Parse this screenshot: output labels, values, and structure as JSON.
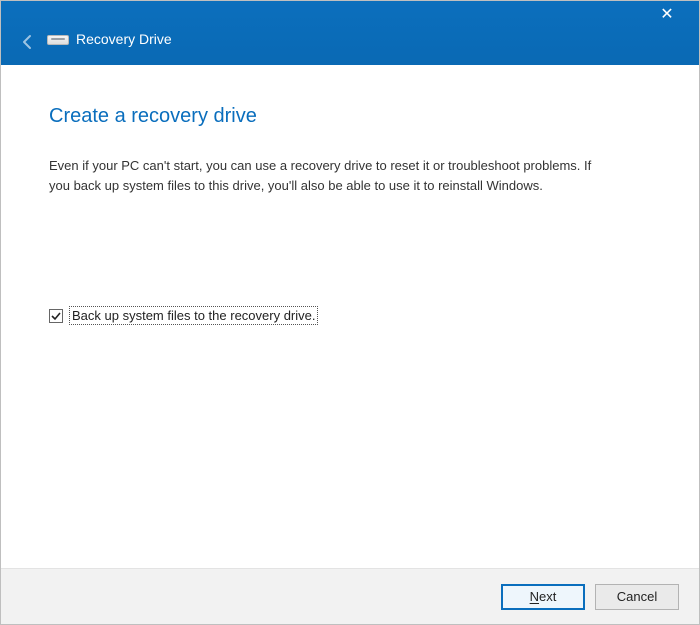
{
  "titlebar": {
    "title": "Recovery Drive"
  },
  "page": {
    "heading": "Create a recovery drive",
    "description": "Even if your PC can't start, you can use a recovery drive to reset it or troubleshoot problems. If you back up system files to this drive, you'll also be able to use it to reinstall Windows."
  },
  "checkbox": {
    "label": "Back up system files to the recovery drive.",
    "checked": true
  },
  "buttons": {
    "next_prefix": "N",
    "next_rest": "ext",
    "cancel": "Cancel"
  },
  "colors": {
    "accent": "#0a6ebd"
  }
}
